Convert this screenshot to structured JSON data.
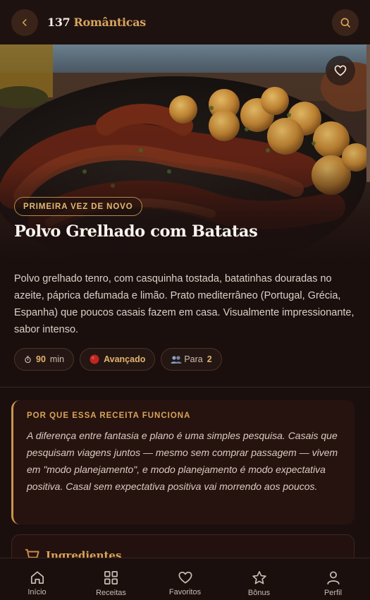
{
  "header": {
    "count": "137",
    "brand_word": "Românticas"
  },
  "recipe": {
    "badge": "PRIMEIRA VEZ DE NOVO",
    "title": "Polvo Grelhado com Batatas",
    "description": "Polvo grelhado tenro, com casquinha tostada, batatinhas douradas no azeite, páprica defumada e limão. Prato mediterrâneo (Portugal, Grécia, Espanha) que poucos casais fazem em casa. Visualmente impressionante, sabor intenso.",
    "time_value": "90",
    "time_unit": "min",
    "difficulty": "Avançado",
    "serves_prefix": "Para",
    "serves_value": "2"
  },
  "why": {
    "title": "POR QUE ESSA RECEITA FUNCIONA",
    "text": "A diferença entre fantasia e plano é uma simples pesquisa. Casais que pesquisam viagens juntos — mesmo sem comprar passagem — vivem em \"modo planejamento\", e modo planejamento é modo expectativa positiva. Casal sem expectativa positiva vai morrendo aos poucos."
  },
  "ingredients": {
    "title": "Ingredientes"
  },
  "nav": [
    {
      "label": "Início",
      "icon": "home-icon"
    },
    {
      "label": "Receitas",
      "icon": "grid-icon"
    },
    {
      "label": "Favoritos",
      "icon": "heart-icon"
    },
    {
      "label": "Bônus",
      "icon": "star-icon"
    },
    {
      "label": "Perfil",
      "icon": "user-icon"
    }
  ],
  "colors": {
    "background": "#1b0f0e",
    "accent": "#d8a45a",
    "difficulty_dot": "#c0261f"
  }
}
